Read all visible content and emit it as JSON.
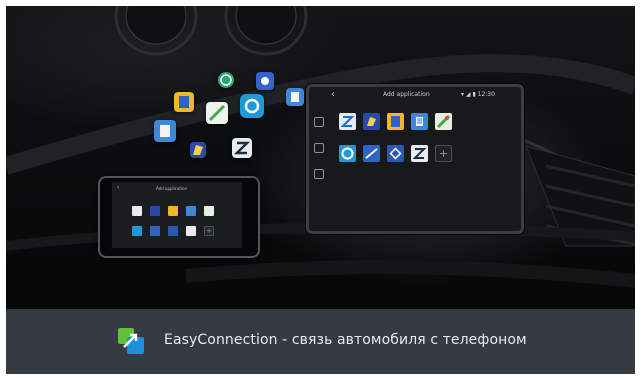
{
  "car_screen": {
    "back_glyph": "‹",
    "title": "Add application",
    "status": "▾ ◢ ▮ 12:30",
    "plus_glyph": "+"
  },
  "phone_screen": {
    "back_glyph": "‹",
    "title": "Add application",
    "plus_glyph": "+"
  },
  "bottom_bar": {
    "brand_icon": "easyconnection-logo-icon",
    "tagline": "EasyConnection - связь автомобиля с телефоном"
  },
  "colors": {
    "bottom_bar_bg": "#353b40",
    "logo_green": "#5ec23a",
    "logo_blue": "#1f8fd8",
    "tagline_text": "#e8eaec"
  },
  "icons": {
    "car_tiles": [
      "z-app-icon",
      "flag-app-icon",
      "note-app-icon",
      "book-app-icon",
      "map-app-icon",
      "e-app-icon",
      "drive-app-icon",
      "compass-app-icon",
      "z-app-icon",
      "add-icon"
    ],
    "phone_tiles": [
      "z-app-icon",
      "flag-app-icon",
      "note-app-icon",
      "book-app-icon",
      "map-app-icon",
      "e-app-icon",
      "drive-app-icon",
      "compass-app-icon",
      "z-app-icon",
      "add-icon"
    ],
    "floating": [
      "book-app-icon",
      "note-app-icon",
      "map-app-icon",
      "e-app-icon",
      "clock-app-icon",
      "gear-app-icon",
      "z-app-icon",
      "flag-app-icon"
    ]
  }
}
